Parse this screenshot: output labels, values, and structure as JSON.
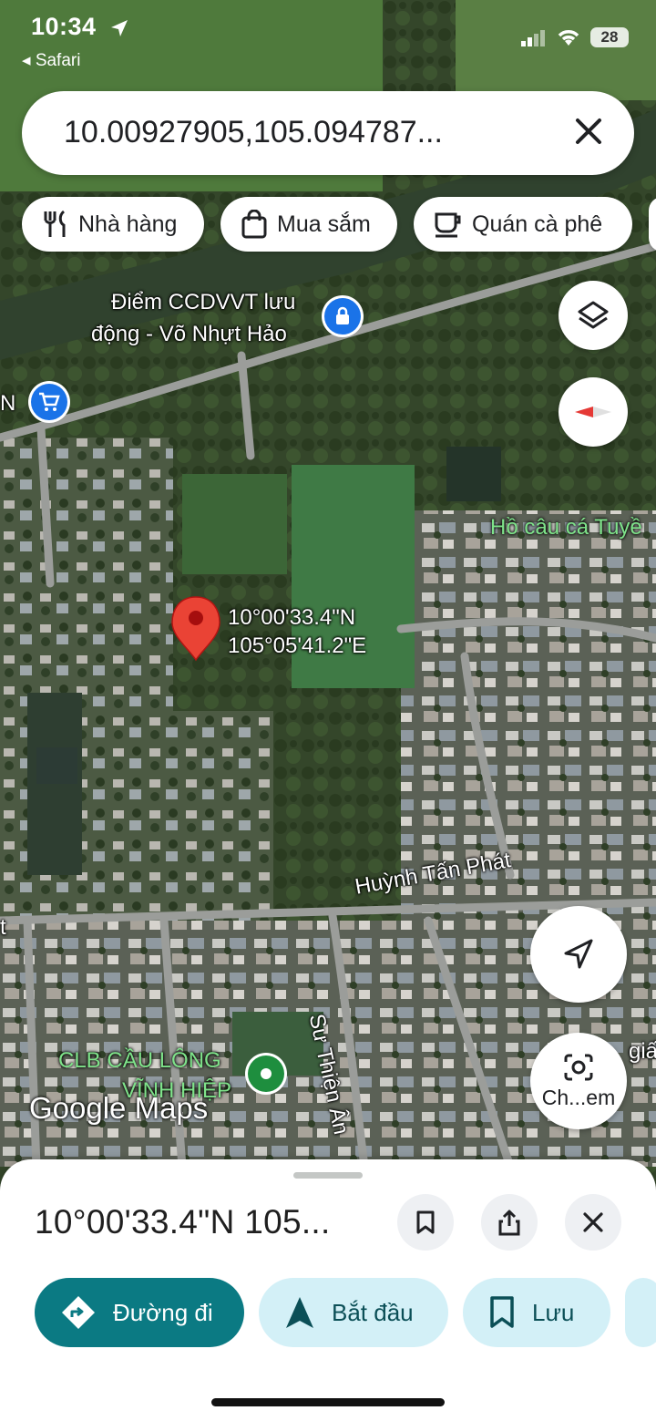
{
  "status_bar": {
    "time": "10:34",
    "back_app": "◂ Safari",
    "battery": "28"
  },
  "search": {
    "query": "10.00927905,105.094787..."
  },
  "chips": [
    {
      "label": "Nhà hàng",
      "icon": "restaurant-icon"
    },
    {
      "label": "Mua sắm",
      "icon": "shopping-bag-icon"
    },
    {
      "label": "Quán cà phê",
      "icon": "coffee-icon"
    }
  ],
  "map": {
    "labels": {
      "poi_cho_line1": "Điểm CCDVVT lưu",
      "poi_cho_line2": "động - Võ Nhựt Hảo",
      "left_edge": "N",
      "ho_cau_ca": "Hồ câu cá Tuyề",
      "pin_coord_line1": "10°00'33.4\"N",
      "pin_coord_line2": "105°05'41.2\"E",
      "street_huynh_tan_phat": "Huỳnh Tấn Phát",
      "street_su_thien_an": "Sư Thiện Ân",
      "clb_line1": "CLB CẦU LÔNG",
      "clb_line2": "VĨNH HIỆP",
      "right_edge": "giấ",
      "left_edge_t": "t",
      "watermark": "Google Maps"
    },
    "pin_color": "#ea4335",
    "poi_color_blue": "#1a73e8",
    "poi_color_green": "#1e8e3e"
  },
  "camera_button": {
    "label": "Ch...em"
  },
  "sheet": {
    "title": "10°00'33.4\"N 105...",
    "actions": [
      {
        "label": "Đường đi",
        "icon": "directions-icon"
      },
      {
        "label": "Bắt đầu",
        "icon": "navigation-arrow-icon"
      },
      {
        "label": "Lưu",
        "icon": "bookmark-icon"
      }
    ]
  },
  "colors": {
    "accent": "#0b7a83",
    "action_light": "#d3f0f7"
  }
}
